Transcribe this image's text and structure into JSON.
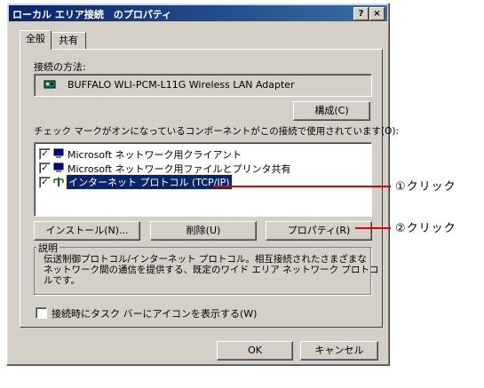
{
  "window": {
    "title": "ローカル エリア接続　のプロパティ",
    "help_button": "?",
    "close_button": "×"
  },
  "tabs": [
    {
      "label": "全般"
    },
    {
      "label": "共有"
    }
  ],
  "connect_using_label": "接続の方法:",
  "adapter_name": "BUFFALO WLI-PCM-L11G Wireless LAN Adapter",
  "configure_button": "構成(C)",
  "components_label": "チェック マークがオンになっているコンポーネントがこの接続で使用されています(O):",
  "components": [
    {
      "label": "Microsoft ネットワーク用クライアント",
      "checked": true,
      "icon": "network-client-icon"
    },
    {
      "label": "Microsoft ネットワーク用ファイルとプリンタ共有",
      "checked": true,
      "icon": "file-printer-sharing-icon"
    },
    {
      "label": "インターネット プロトコル (TCP/IP)",
      "checked": true,
      "icon": "protocol-icon",
      "selected": true
    }
  ],
  "buttons": {
    "install": "インストール(N)...",
    "remove": "削除(U)",
    "properties": "プロパティ(R)"
  },
  "description": {
    "heading": "説明",
    "text_lines": [
      "伝送制御プロトコル/インターネット プロトコル。相互接続されたさまざまな",
      "ネットワーク間の通信を提供する、既定のワイド エリア ネットワーク プロトコ",
      "ルです。"
    ]
  },
  "taskbar_icon_checkbox": {
    "label": "接続時にタスク バーにアイコンを表示する(W)",
    "checked": false
  },
  "ok_button": "OK",
  "cancel_button": "キャンセル",
  "annotations": {
    "step1": "①クリック",
    "step2": "②クリック",
    "line_color": "#e00000"
  },
  "colors": {
    "dialog_bg": "#d4d0c8",
    "selection": "#0a246a",
    "title_gradient_start": "#0a246a",
    "title_gradient_end": "#3a6ea5"
  }
}
